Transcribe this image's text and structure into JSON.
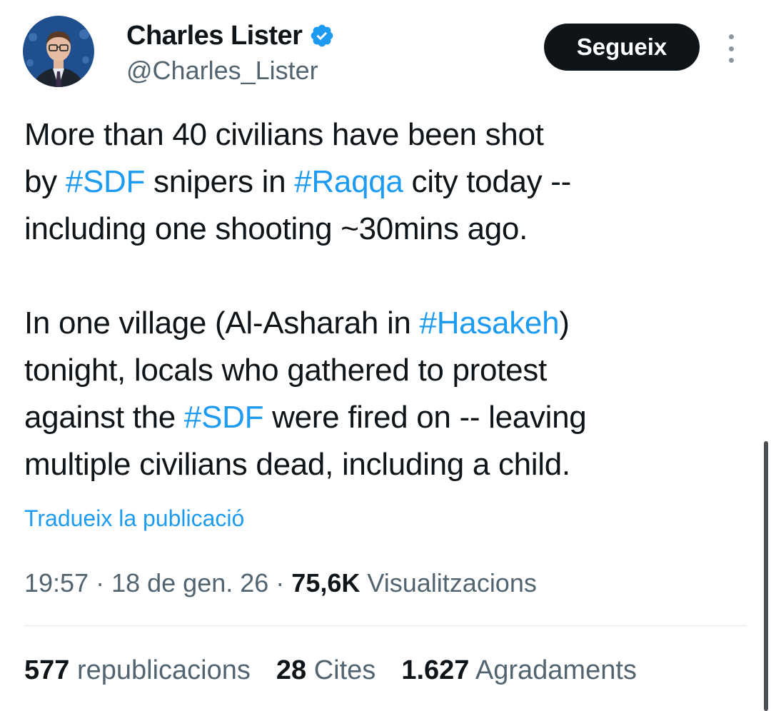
{
  "author": {
    "display_name": "Charles Lister",
    "handle": "@Charles_Lister",
    "verified_icon": "verified-badge-icon",
    "avatar_icon": "avatar-photo"
  },
  "actions": {
    "follow_label": "Segueix",
    "more_icon": "more-vertical-icon"
  },
  "tweet": {
    "paragraph1": [
      [
        {
          "t": "More than 40 civilians have been shot",
          "h": false
        }
      ],
      [
        {
          "t": "by ",
          "h": false
        },
        {
          "t": "#SDF",
          "h": true
        },
        {
          "t": " snipers in ",
          "h": false
        },
        {
          "t": "#Raqqa",
          "h": true
        },
        {
          "t": " city today --",
          "h": false
        }
      ],
      [
        {
          "t": "including one shooting ~30mins ago.",
          "h": false
        }
      ]
    ],
    "paragraph2": [
      [
        {
          "t": "In one village (Al-Asharah in ",
          "h": false
        },
        {
          "t": "#Hasakeh",
          "h": true
        },
        {
          "t": ")",
          "h": false
        }
      ],
      [
        {
          "t": "tonight, locals who gathered to protest",
          "h": false
        }
      ],
      [
        {
          "t": "against the ",
          "h": false
        },
        {
          "t": "#SDF",
          "h": true
        },
        {
          "t": " were fired on -- leaving",
          "h": false
        }
      ],
      [
        {
          "t": "multiple civilians dead, including a child.",
          "h": false
        }
      ]
    ],
    "translate_label": "Tradueix la publicació"
  },
  "meta": {
    "time": "19:57",
    "separator": " · ",
    "date": "18 de gen. 26",
    "views_count": "75,6K",
    "views_label": "Visualitzacions"
  },
  "stats": {
    "reposts_count": "577",
    "reposts_label": "republicacions",
    "quotes_count": "28",
    "quotes_label": "Cites",
    "likes_count": "1.627",
    "likes_label": "Agradaments"
  },
  "colors": {
    "link": "#1d9bf0",
    "text": "#0f1419",
    "secondary": "#536471",
    "button_bg": "#0f1419"
  }
}
